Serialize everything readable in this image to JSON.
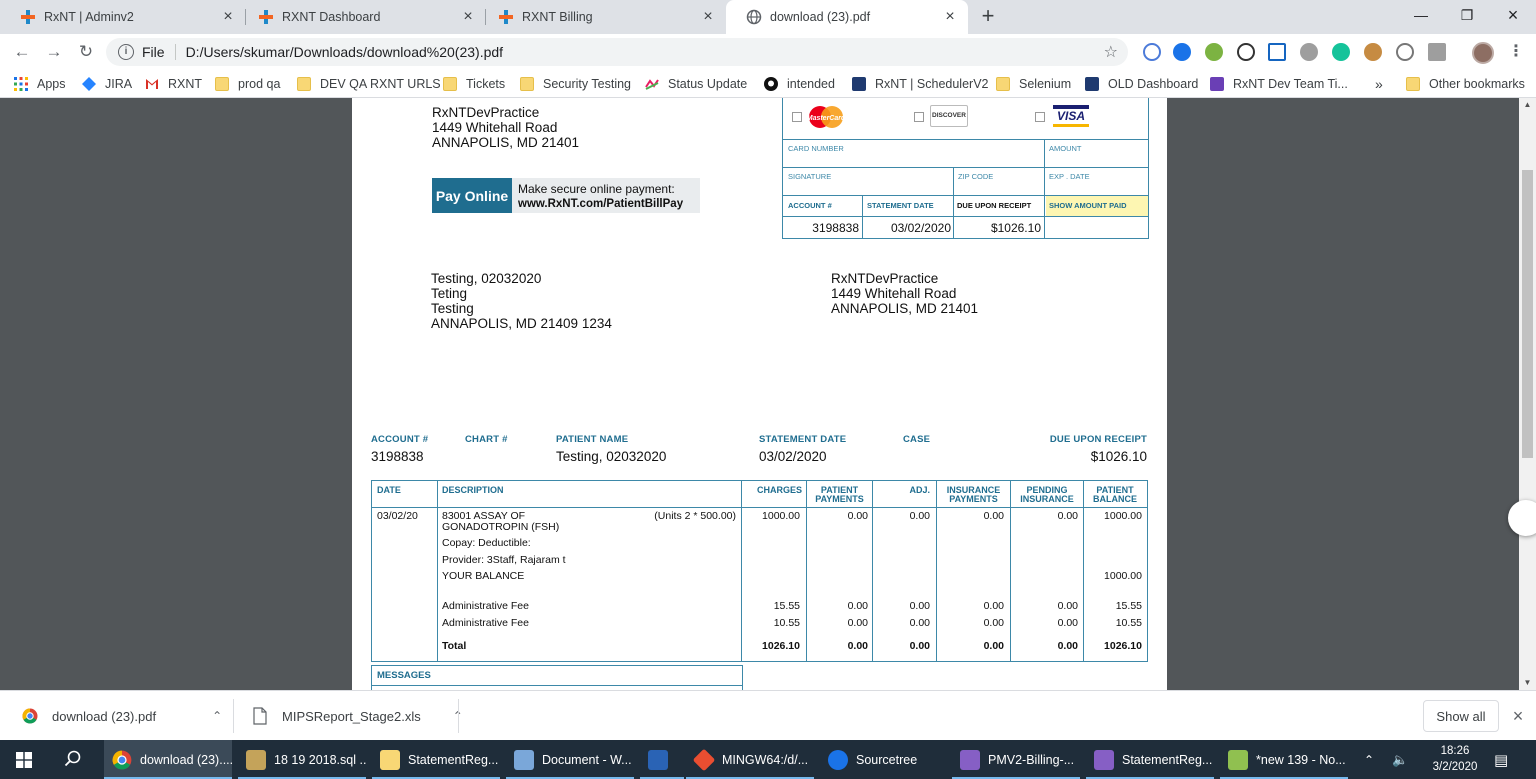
{
  "browser": {
    "tabs": [
      {
        "label": "RxNT | Adminv2",
        "active": false
      },
      {
        "label": "RXNT Dashboard",
        "active": false
      },
      {
        "label": "RXNT Billing",
        "active": false
      },
      {
        "label": "download (23).pdf",
        "active": true
      }
    ],
    "new_tab": "+",
    "address_scheme": "File",
    "address_url": "D:/Users/skumar/Downloads/download%20(23).pdf",
    "bookmarks": [
      "Apps",
      "JIRA",
      "RXNT",
      "prod qa",
      "DEV QA RXNT URLS",
      "Tickets",
      "Security Testing",
      "Status Update",
      "intended",
      "RxNT | SchedulerV2",
      "Selenium",
      "OLD Dashboard",
      "RxNT Dev Team Ti...",
      "Other bookmarks"
    ],
    "bookmarks_overflow": "»"
  },
  "statement": {
    "practice_addr": [
      "RxNTDevPractice",
      "1449 Whitehall Road",
      "ANNAPOLIS, MD 21401"
    ],
    "pay_online": {
      "button": "Pay Online",
      "line1": "Make secure online payment:",
      "line2": "www.RxNT.com/PatientBillPay"
    },
    "card_logos": {
      "mastercard": "MasterCard",
      "discover": "DISCOVER",
      "visa": "VISA"
    },
    "card_labels": {
      "card_number": "CARD NUMBER",
      "amount": "AMOUNT",
      "signature": "SIGNATURE",
      "zip": "ZIP CODE",
      "exp": "EXP . DATE"
    },
    "stub_headers": {
      "account": "ACCOUNT #",
      "statement_date": "STATEMENT DATE",
      "due": "DUE UPON RECEIPT",
      "show_paid": "SHOW AMOUNT PAID"
    },
    "stub_values": {
      "account": "3198838",
      "statement_date": "03/02/2020",
      "due": "$1026.10"
    },
    "patient_addr": [
      "Testing, 02032020",
      "Teting",
      "Testing",
      "ANNAPOLIS, MD 21409 1234"
    ],
    "remit_addr": [
      "RxNTDevPractice",
      "1449 Whitehall Road",
      "ANNAPOLIS, MD 21401"
    ],
    "summary_headers": {
      "account": "ACCOUNT #",
      "chart": "CHART #",
      "patient": "PATIENT NAME",
      "statement_date": "STATEMENT DATE",
      "case": "CASE",
      "due": "DUE UPON RECEIPT"
    },
    "summary_values": {
      "account": "3198838",
      "patient": "Testing, 02032020",
      "statement_date": "03/02/2020",
      "due": "$1026.10"
    },
    "ledger_headers": {
      "date": "DATE",
      "description": "DESCRIPTION",
      "charges": "CHARGES",
      "patient_payments_1": "PATIENT",
      "patient_payments_2": "PAYMENTS",
      "adj": "ADJ.",
      "insurance_payments_1": "INSURANCE",
      "insurance_payments_2": "PAYMENTS",
      "pending_1": "PENDING",
      "pending_2": "INSURANCE",
      "balance_1": "PATIENT",
      "balance_2": "BALANCE"
    },
    "ledger": {
      "svc_date": "03/02/20",
      "svc_desc_1": "83001 ASSAY OF",
      "svc_desc_2": "GONADOTROPIN (FSH)",
      "svc_units": "(Units 2 * 500.00)",
      "svc_charges": "1000.00",
      "svc_pat_pay": "0.00",
      "svc_adj": "0.00",
      "svc_ins_pay": "0.00",
      "svc_pending": "0.00",
      "svc_balance": "1000.00",
      "copay": "Copay:   Deductible:",
      "provider": "Provider: 3Staff, Rajaram t",
      "your_balance": "YOUR BALANCE",
      "your_balance_val": "1000.00",
      "fees": [
        {
          "desc": "Administrative Fee",
          "charges": "15.55",
          "pat_pay": "0.00",
          "adj": "0.00",
          "ins_pay": "0.00",
          "pending": "0.00",
          "balance": "15.55"
        },
        {
          "desc": "Administrative Fee",
          "charges": "10.55",
          "pat_pay": "0.00",
          "adj": "0.00",
          "ins_pay": "0.00",
          "pending": "0.00",
          "balance": "10.55"
        }
      ],
      "total": {
        "label": "Total",
        "charges": "1026.10",
        "pat_pay": "0.00",
        "adj": "0.00",
        "ins_pay": "0.00",
        "pending": "0.00",
        "balance": "1026.10"
      }
    },
    "messages_header": "MESSAGES"
  },
  "downloads": {
    "items": [
      "download (23).pdf",
      "MIPSReport_Stage2.xls"
    ],
    "show_all": "Show all"
  },
  "taskbar": {
    "items": [
      "download (23)....",
      "18 19 2018.sql ...",
      "StatementReg...",
      "Document - W...",
      "",
      "MINGW64:/d/...",
      "Sourcetree",
      "PMV2-Billing-...",
      "StatementReg...",
      "*new 139 - No..."
    ],
    "time": "18:26",
    "date": "3/2/2020"
  },
  "colors": {
    "accent": "#1f6d8f",
    "line": "#3d88a8",
    "highlight": "#fdf6b2"
  }
}
